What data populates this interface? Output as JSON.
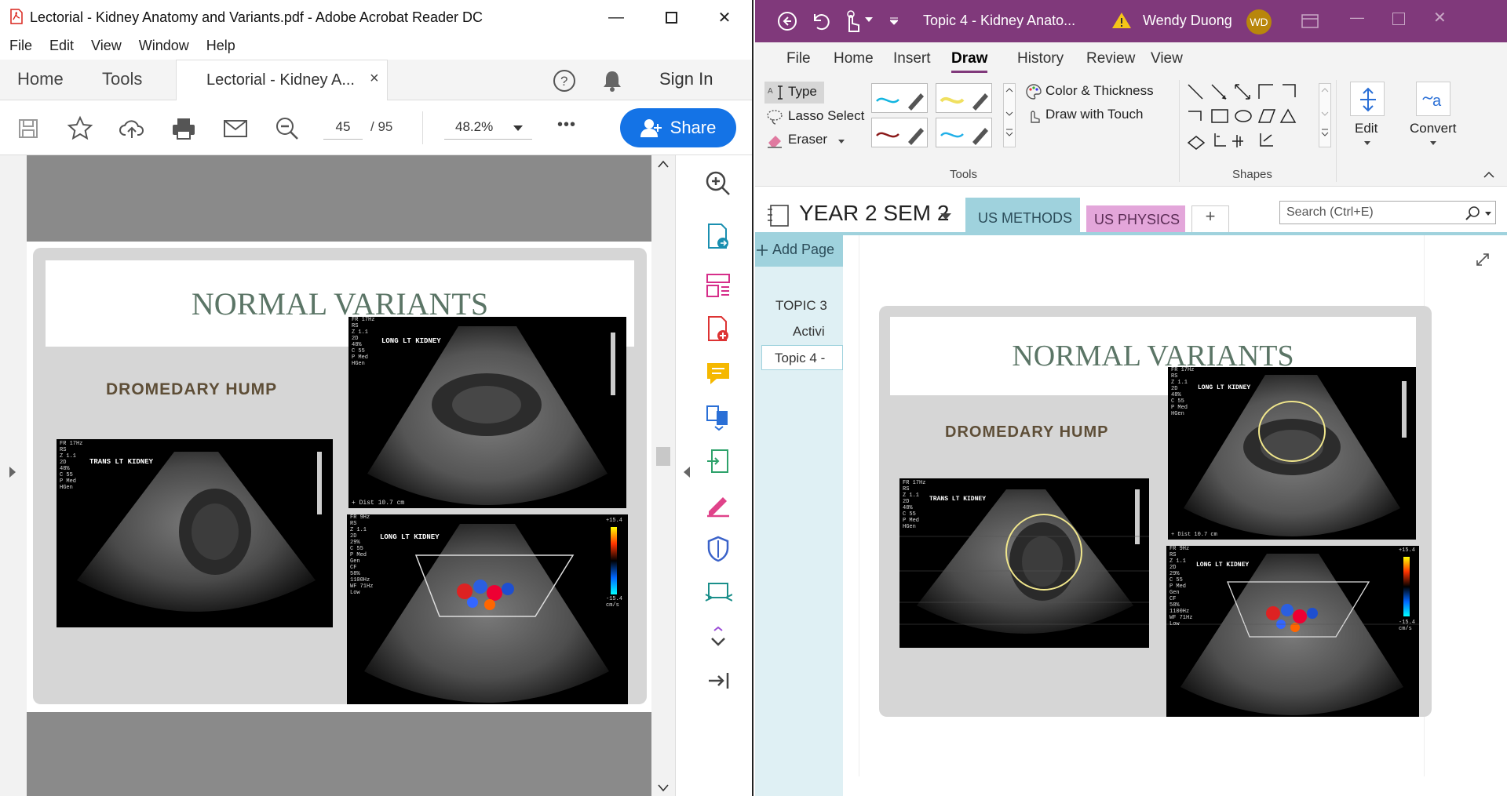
{
  "acrobat": {
    "title": "Lectorial - Kidney Anatomy and Variants.pdf - Adobe Acrobat Reader DC",
    "menu": [
      "File",
      "Edit",
      "View",
      "Window",
      "Help"
    ],
    "tabs": {
      "home": "Home",
      "tools": "Tools",
      "doc": "Lectorial - Kidney A...",
      "close": "×"
    },
    "sign_in": "Sign In",
    "page_current": "45",
    "page_total": "/ 95",
    "zoom": "48.2%",
    "more": "•••",
    "share": "Share",
    "accent": "#1473e6"
  },
  "slide": {
    "title": "NORMAL VARIANTS",
    "subtitle": "DROMEDARY HUMP",
    "images": {
      "trans": {
        "label": "TRANS   LT KIDNEY",
        "meta": "FR 17Hz\nRS\nZ 1.1\n2D\n48%\nC 55\nP Med\nHGen"
      },
      "long_top": {
        "label": "LONG   LT KIDNEY",
        "meta": "FR 17Hz\nRS\nZ 1.1\n2D\n48%\nC 55\nP Med\nHGen",
        "dist": "+ Dist  10.7 cm"
      },
      "long_color": {
        "label": "LONG   LT KIDNEY",
        "meta": "FR 9Hz\nRS\nZ 1.1\n2D\n29%\nC 55\nP Med\nGen\nCF\n58%\n1100Hz\nWF 71Hz\nLow",
        "scale_top": "+15.4",
        "scale_bot": "-15.4\ncm/s"
      }
    }
  },
  "onenote": {
    "title": "Topic 4 - Kidney Anato...",
    "user": "Wendy Duong",
    "initials": "WD",
    "title_color": "#80397b",
    "ribbon_tabs": [
      "File",
      "Home",
      "Insert",
      "Draw",
      "History",
      "Review",
      "View"
    ],
    "active_tab": "Draw",
    "tools": {
      "type": "Type",
      "lasso": "Lasso Select",
      "eraser": "Eraser",
      "color": "Color & Thickness",
      "touch": "Draw with Touch",
      "group": "Tools"
    },
    "shapes_group": "Shapes",
    "edit": "Edit",
    "convert": "Convert",
    "notebook": "YEAR 2 SEM 2",
    "sections": [
      "US METHODS",
      "US PHYSICS",
      "+"
    ],
    "search_placeholder": "Search (Ctrl+E)",
    "add_page": "Add Page",
    "pages": [
      "TOPIC 3",
      "Activi",
      "Topic 4 -"
    ]
  }
}
